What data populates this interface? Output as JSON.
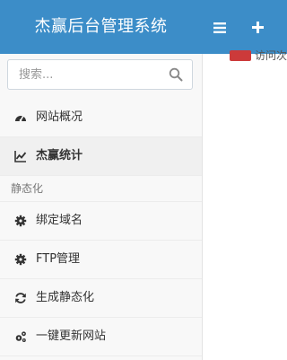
{
  "header": {
    "title": "杰赢后台管理系统",
    "menu_icon": "hamburger-icon",
    "add_icon": "plus-icon"
  },
  "sidebar": {
    "search": {
      "placeholder": "搜索...",
      "value": ""
    },
    "items": [
      {
        "label": "网站概况",
        "icon": "dashboard-icon",
        "active": false
      },
      {
        "label": "杰赢统计",
        "icon": "line-chart-icon",
        "active": true
      }
    ],
    "group_label": "静态化",
    "group_items": [
      {
        "label": "绑定域名",
        "icon": "gear-icon"
      },
      {
        "label": "FTP管理",
        "icon": "gear-icon"
      },
      {
        "label": "生成静态化",
        "icon": "refresh-icon"
      },
      {
        "label": "一键更新网站",
        "icon": "gears-icon"
      }
    ]
  },
  "content": {
    "stat_label": "访问次"
  },
  "colors": {
    "header_bg": "#3c8dc8",
    "badge_red": "#cc3a3a",
    "sidebar_bg": "#f8f8f8"
  }
}
